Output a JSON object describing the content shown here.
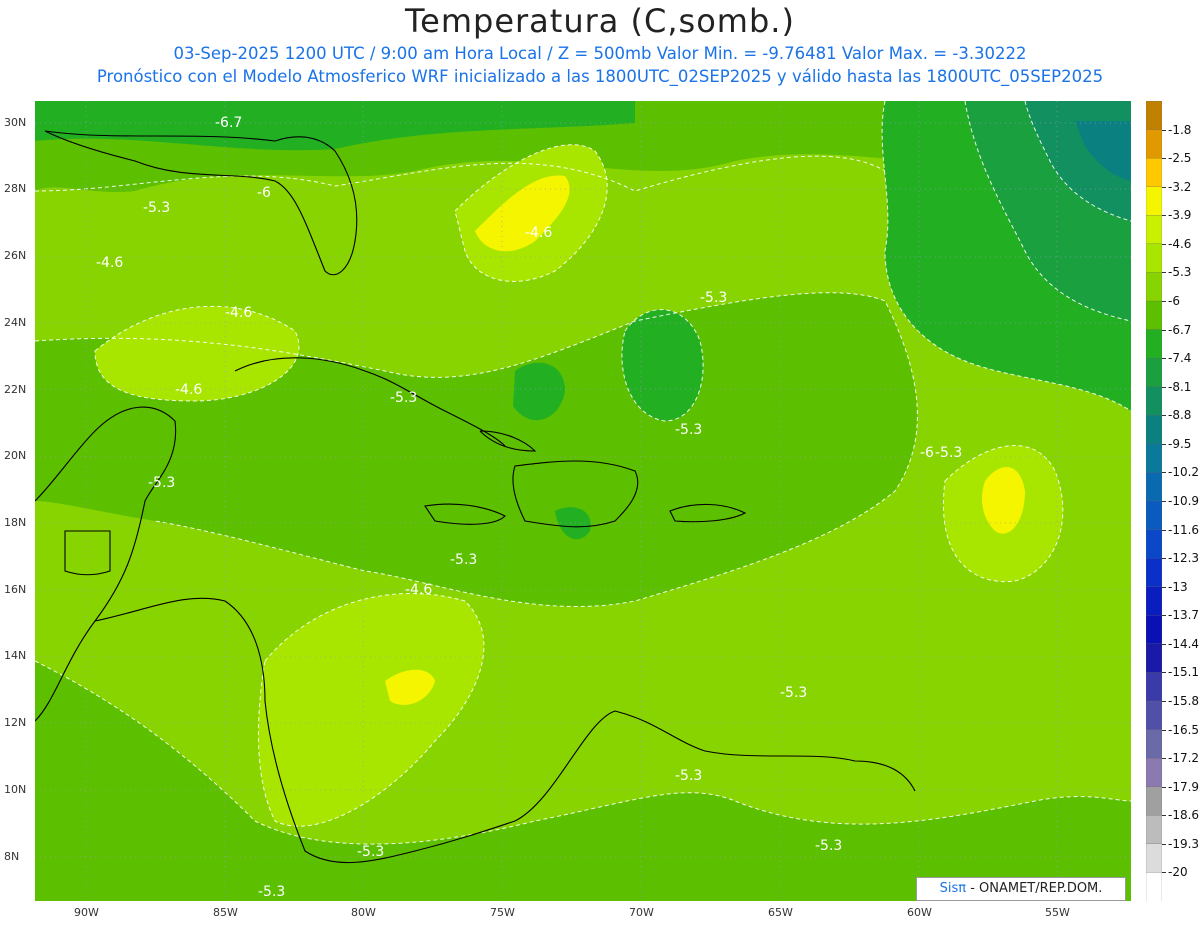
{
  "title": "Temperatura (C,somb.)",
  "subtitle_1": "03-Sep-2025  1200 UTC / 9:00 am Hora Local / Z = 500mb  Valor Min. = -9.76481  Valor Max. = -3.30222",
  "subtitle_2": "Pronóstico con el Modelo Atmosferico WRF inicializado a las 1800UTC_02SEP2025 y válido hasta las  1800UTC_05SEP2025",
  "credit": {
    "brand": "Sisπ",
    "text": " - ONAMET/REP.DOM."
  },
  "lat_labels": [
    "30N",
    "28N",
    "26N",
    "24N",
    "22N",
    "20N",
    "18N",
    "16N",
    "14N",
    "12N",
    "10N",
    "8N"
  ],
  "lon_labels": [
    "90W",
    "85W",
    "80W",
    "75W",
    "70W",
    "65W",
    "60W",
    "55W"
  ],
  "colorbar": {
    "labels": [
      "-1.8",
      "-2.5",
      "-3.2",
      "-3.9",
      "-4.6",
      "-5.3",
      "-6",
      "-6.7",
      "-7.4",
      "-8.1",
      "-8.8",
      "-9.5",
      "-10.2",
      "-10.9",
      "-11.6",
      "-12.3",
      "-13",
      "-13.7",
      "-14.4",
      "-15.1",
      "-15.8",
      "-16.5",
      "-17.2",
      "-17.9",
      "-18.6",
      "-19.3",
      "-20"
    ],
    "colors": [
      "#c08000",
      "#e09a00",
      "#ffc800",
      "#f5f500",
      "#c8f000",
      "#a8e600",
      "#88d400",
      "#5cbf00",
      "#22b022",
      "#1ba040",
      "#129060",
      "#0a8080",
      "#0a7a9a",
      "#0a6ab0",
      "#0a5ac0",
      "#0a48c8",
      "#0a30c8",
      "#0a1ec0",
      "#0a10b4",
      "#1a1aa8",
      "#3a3aa8",
      "#5050a8",
      "#6a6aa8",
      "#8a7ab0",
      "#a0a0a0",
      "#bcbcbc",
      "#dcdcdc",
      "#ffffff"
    ]
  },
  "contour_labels": [
    "-6.7",
    "-6",
    "-5.3",
    "-4.6",
    "-4.6",
    "-4.6",
    "-4.6",
    "-5.3",
    "-5.3",
    "-5.3",
    "-6",
    "-5.3",
    "-5.3",
    "-4.6",
    "-5.3",
    "-5.3",
    "-5.3",
    "-5.3",
    "-5.3",
    "-5.3"
  ],
  "colors": {
    "subtitle": "#1a73e8",
    "title": "#222222"
  }
}
